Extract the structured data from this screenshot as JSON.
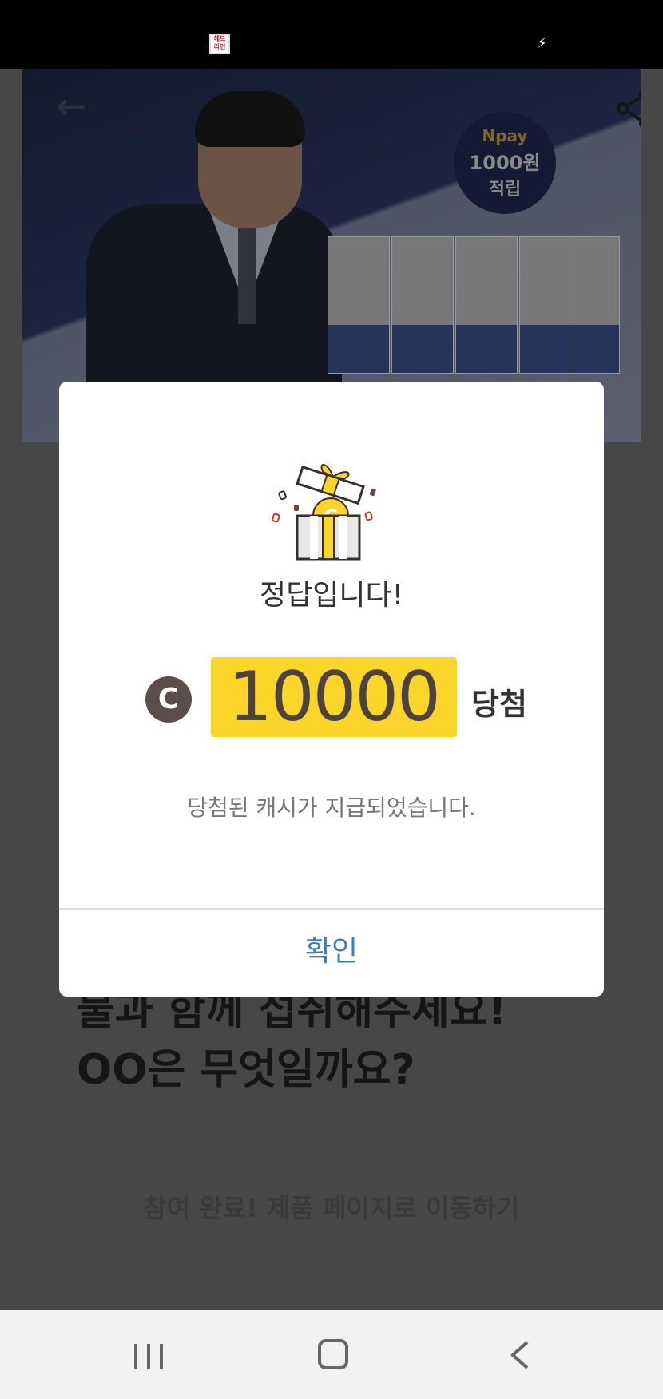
{
  "status_bar": {
    "app_icon_text": "헤드라인"
  },
  "banner": {
    "badge": {
      "line1": "Npay",
      "line2": "1000원",
      "line3": "적립"
    }
  },
  "question": {
    "text": "더부룩할 때 마~지근한\n물과 함께 섭취해주세요!\nOO은 무엇일까요?"
  },
  "product_link": "참여 완료! 제품 페이지로 이동하기",
  "modal": {
    "title": "정답입니다!",
    "coin_symbol": "C",
    "amount": "10000",
    "win_label": "당첨",
    "message": "당첨된 캐시가 지급되었습니다.",
    "confirm_label": "확인"
  },
  "colors": {
    "accent": "#fcd52a",
    "confirm": "#3d7fb8",
    "coin": "#5b4d48"
  }
}
